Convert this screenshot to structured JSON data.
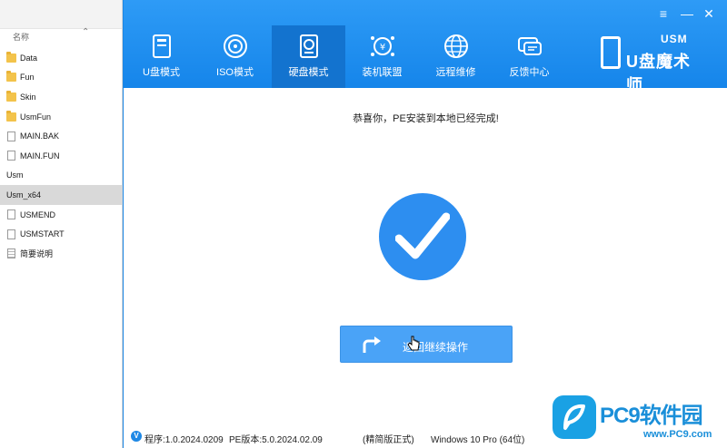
{
  "explorer": {
    "column_name": "名称",
    "files": [
      {
        "name": "Data",
        "icon": "folder-icon"
      },
      {
        "name": "Fun",
        "icon": "folder-icon"
      },
      {
        "name": "Skin",
        "icon": "folder-icon"
      },
      {
        "name": "UsmFun",
        "icon": "folder-icon"
      },
      {
        "name": "MAIN.BAK",
        "icon": "file-icon"
      },
      {
        "name": "MAIN.FUN",
        "icon": "file-icon"
      },
      {
        "name": "Usm",
        "icon": "app-icon"
      },
      {
        "name": "Usm_x64",
        "icon": "app-icon",
        "selected": true
      },
      {
        "name": "USMEND",
        "icon": "file-icon"
      },
      {
        "name": "USMSTART",
        "icon": "file-icon"
      },
      {
        "name": "简要说明",
        "icon": "text-file-icon"
      }
    ]
  },
  "app": {
    "window_controls": {
      "menu": "≡",
      "minimize": "—",
      "close": "✕"
    },
    "tabs": [
      {
        "label": "U盘模式",
        "icon": "usb-drive-icon"
      },
      {
        "label": "ISO模式",
        "icon": "disc-icon"
      },
      {
        "label": "硬盘模式",
        "icon": "hard-disk-icon",
        "active": true
      },
      {
        "label": "装机联盟",
        "icon": "money-network-icon"
      },
      {
        "label": "远程维修",
        "icon": "globe-icon"
      },
      {
        "label": "反馈中心",
        "icon": "chat-bubble-icon"
      }
    ],
    "logo": {
      "usm": "USM",
      "brand": "U盘魔术师"
    },
    "message": "恭喜你，PE安装到本地已经完成!",
    "return_button": "返回继续操作",
    "status": {
      "version_badge": "V",
      "program": "程序:1.0.2024.0209",
      "pe_version": "PE版本:5.0.2024.02.09",
      "edition": "(精简版正式)",
      "os": "Windows 10 Pro (64位)"
    }
  },
  "watermark": {
    "text": "PC9软件园",
    "url": "www.PC9.com"
  },
  "colors": {
    "header_blue": "#1e8ff0",
    "active_tab": "#1373cf",
    "check_blue": "#2d8ef0",
    "button_blue": "#4aa3f7"
  }
}
